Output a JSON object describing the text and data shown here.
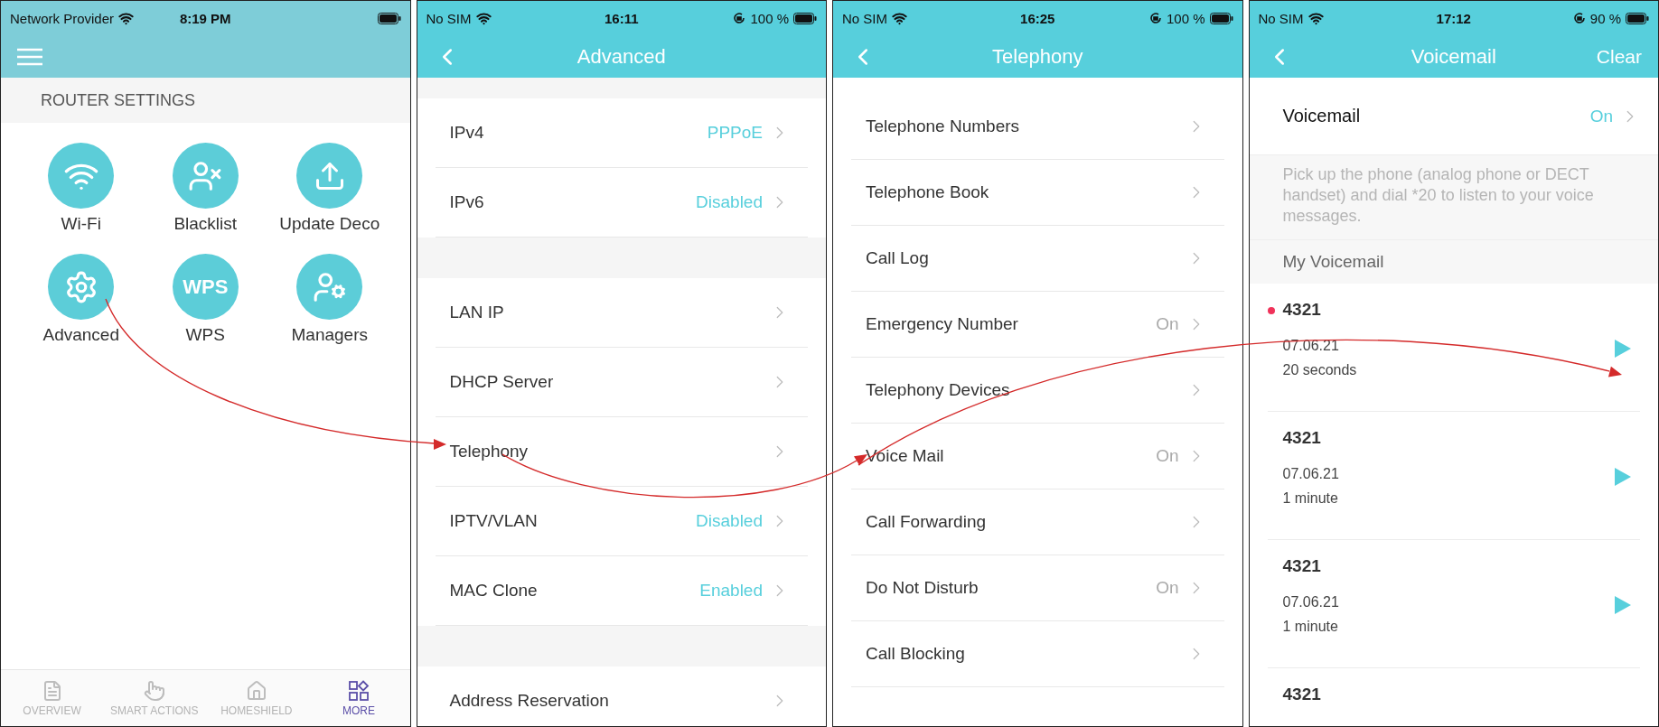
{
  "screens": [
    {
      "kind": "router_settings",
      "status_bar": {
        "carrier": "Network Provider",
        "time": "8:19 PM"
      },
      "section_title": "ROUTER SETTINGS",
      "tiles": [
        {
          "label": "Wi-Fi"
        },
        {
          "label": "Blacklist"
        },
        {
          "label": "Update Deco"
        },
        {
          "label": "Advanced"
        },
        {
          "label": "WPS",
          "icon_text": "WPS"
        },
        {
          "label": "Managers"
        }
      ],
      "bottom_nav": [
        {
          "label": "OVERVIEW",
          "selected": false
        },
        {
          "label": "SMART ACTIONS",
          "selected": false
        },
        {
          "label": "HOMESHIELD",
          "selected": false
        },
        {
          "label": "MORE",
          "selected": true
        }
      ]
    },
    {
      "kind": "settings_list",
      "status_bar": {
        "carrier": "No SIM",
        "time": "16:11",
        "battery": "100 %"
      },
      "title": "Advanced",
      "grouped": true,
      "groups": [
        [
          {
            "label": "IPv4",
            "value": "PPPoE"
          },
          {
            "label": "IPv6",
            "value": "Disabled"
          }
        ],
        [
          {
            "label": "LAN IP"
          },
          {
            "label": "DHCP Server"
          },
          {
            "label": "Telephony"
          },
          {
            "label": "IPTV/VLAN",
            "value": "Disabled"
          },
          {
            "label": "MAC Clone",
            "value": "Enabled"
          }
        ],
        [
          {
            "label": "Address Reservation"
          }
        ]
      ]
    },
    {
      "kind": "settings_list",
      "status_bar": {
        "carrier": "No SIM",
        "time": "16:25",
        "battery": "100 %"
      },
      "title": "Telephony",
      "grouped": false,
      "groups": [
        [
          {
            "label": "Telephone Numbers"
          },
          {
            "label": "Telephone Book"
          },
          {
            "label": "Call Log"
          },
          {
            "label": "Emergency Number",
            "value": "On"
          },
          {
            "label": "Telephony Devices"
          },
          {
            "label": "Voice Mail",
            "value": "On"
          },
          {
            "label": "Call Forwarding"
          },
          {
            "label": "Do Not Disturb",
            "value": "On"
          },
          {
            "label": "Call Blocking"
          }
        ]
      ]
    },
    {
      "kind": "voicemail",
      "status_bar": {
        "carrier": "No SIM",
        "time": "17:12",
        "battery": "90 %"
      },
      "title": "Voicemail",
      "action": "Clear",
      "setting": {
        "label": "Voicemail",
        "value": "On"
      },
      "note": "Pick up the phone (analog phone or DECT handset) and dial *20 to listen to your voice messages.",
      "section_title": "My Voicemail",
      "messages": [
        {
          "number": "4321",
          "date": "07.06.21",
          "duration": "20 seconds",
          "unread": true
        },
        {
          "number": "4321",
          "date": "07.06.21",
          "duration": "1 minute",
          "unread": false
        },
        {
          "number": "4321",
          "date": "07.06.21",
          "duration": "1 minute",
          "unread": false
        },
        {
          "number": "4321",
          "unread": false
        }
      ]
    }
  ]
}
